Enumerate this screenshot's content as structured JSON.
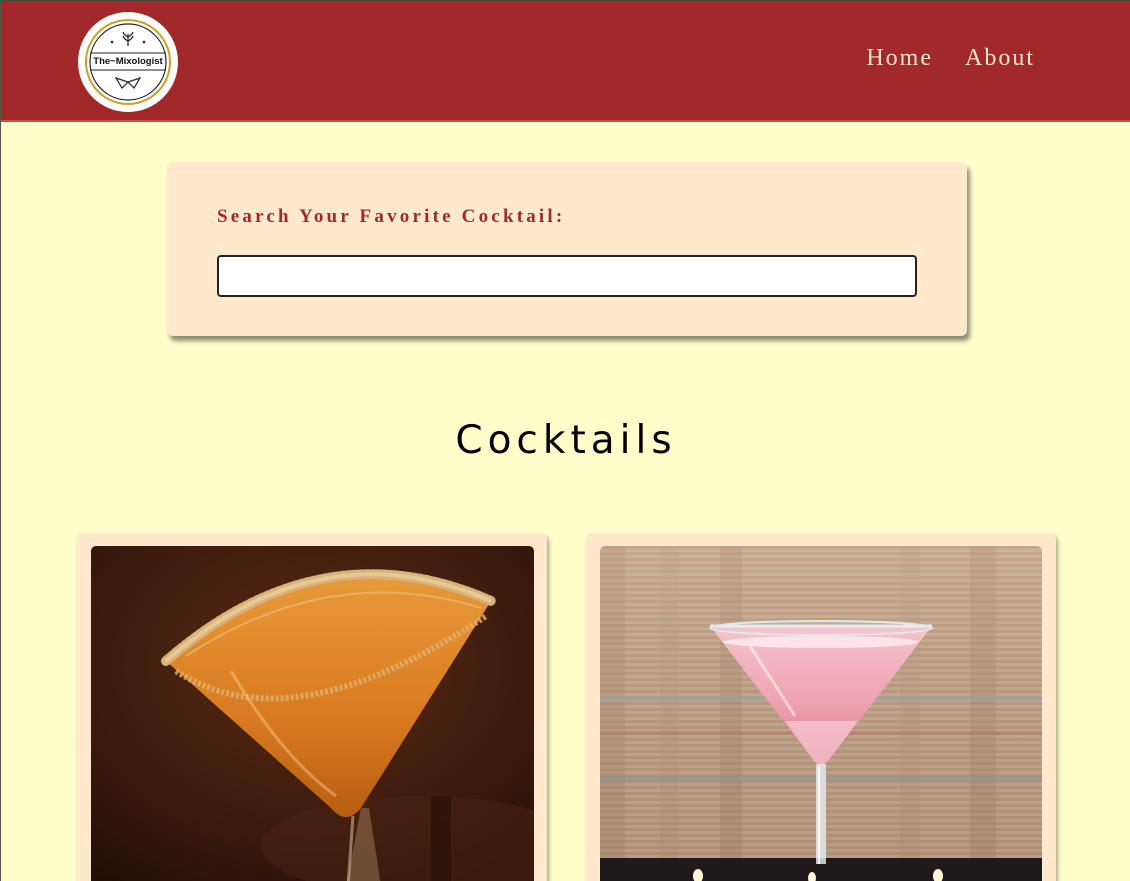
{
  "header": {
    "logo_text": "The~Mixologist",
    "nav": [
      {
        "label": "Home"
      },
      {
        "label": "About"
      }
    ]
  },
  "search": {
    "label": "Search Your Favorite Cocktail:",
    "value": "",
    "placeholder": ""
  },
  "main": {
    "section_title": "Cocktails",
    "cards": [
      {
        "image": "amber-martini-sugar-rim-photo",
        "accent": "#d9862a"
      },
      {
        "image": "pink-martini-photo",
        "accent": "#f2a6b5"
      }
    ]
  },
  "colors": {
    "header_bg": "#a1292a",
    "page_bg": "#ffffcc",
    "card_bg": "#ffe9cc",
    "label_color": "#a1292a",
    "nav_text": "#f5e6d0"
  }
}
